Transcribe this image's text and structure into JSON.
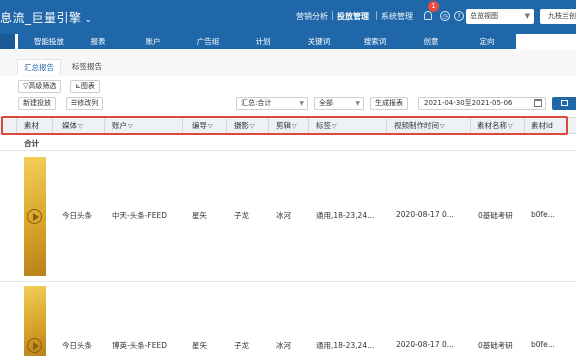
{
  "header": {
    "app_title": "息流_巨量引擎",
    "nav": [
      "营销分析",
      "投放管理",
      "系统管理"
    ],
    "active_nav": "投放管理",
    "notification_count": "1",
    "view_select": "总览视图",
    "account": "九枝兰创"
  },
  "tabs": [
    "",
    "智能投放",
    "报表",
    "账户",
    "广告组",
    "计划",
    "关键词",
    "搜索词",
    "创意",
    "定向"
  ],
  "subtabs": [
    "汇总报告",
    "标签报告"
  ],
  "toolbar": {
    "advanced_filter": "高级筛选",
    "chart": "图表",
    "new_placement": "新建投放",
    "edit_columns": "修改列",
    "summary_select": "汇总:合计",
    "scope_select": "全部",
    "generate_report": "生成报表",
    "date_range": "2021-04-30至2021-05-06"
  },
  "table": {
    "columns": [
      "素材",
      "媒体",
      "账户",
      "编导",
      "摄影",
      "剪辑",
      "标签",
      "视频制作时间",
      "素材名称",
      "素材id"
    ],
    "filterable": [
      false,
      true,
      true,
      true,
      true,
      true,
      true,
      true,
      true,
      false
    ],
    "summary_label": "合计",
    "rows": [
      [
        "",
        "今日头条",
        "中天-头条-FEED",
        "星矢",
        "子龙",
        "冰河",
        "通用,18-23,24...",
        "2020-08-17 0...",
        "0基础考研",
        "b0fe..."
      ],
      [
        "",
        "今日头条",
        "博英-头条-FEED",
        "星矢",
        "子龙",
        "冰河",
        "通用,18-23,24...",
        "2020-08-17 0...",
        "0基础考研",
        "b0fe..."
      ]
    ]
  },
  "colors": {
    "header_bg": "#1f67a9",
    "highlight_frame": "#d94a3a",
    "badge": "#e74c3c",
    "thumbnail": "#e2b13a"
  }
}
